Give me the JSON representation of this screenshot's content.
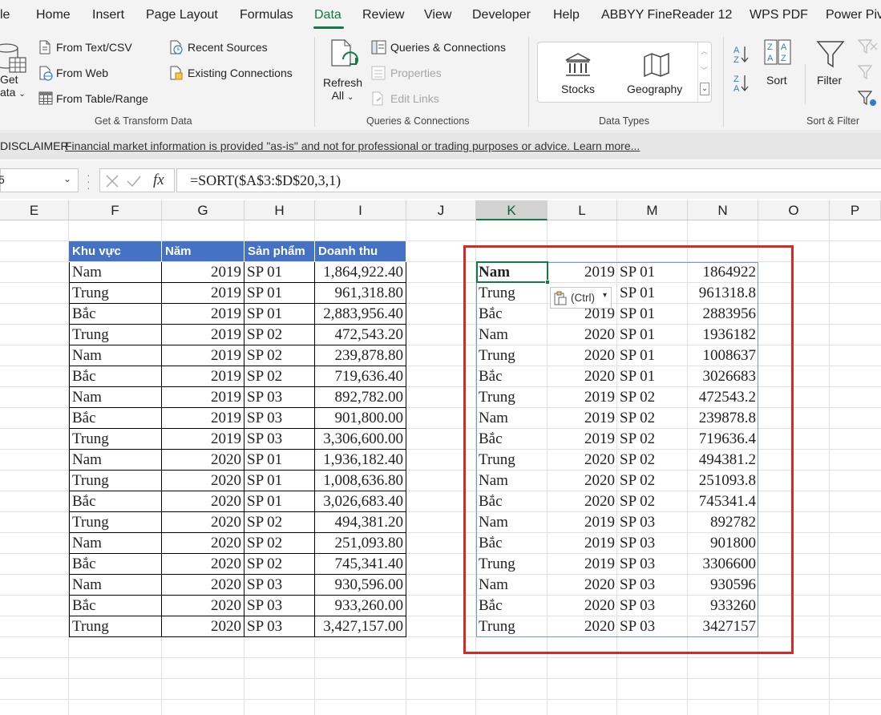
{
  "ribbon_tabs": [
    "le",
    "Home",
    "Insert",
    "Page Layout",
    "Formulas",
    "Data",
    "Review",
    "View",
    "Developer",
    "Help",
    "ABBYY FineReader 12",
    "WPS PDF",
    "Power Piv"
  ],
  "active_tab": "Data",
  "ribbon": {
    "get_data_line1": "Get",
    "get_data_line2": "ata",
    "get_transform_items": [
      "From Text/CSV",
      "From Web",
      "From Table/Range"
    ],
    "recent_sources": "Recent Sources",
    "existing_connections": "Existing Connections",
    "get_transform_label": "Get & Transform Data",
    "refresh_line1": "Refresh",
    "refresh_line2": "All",
    "queries_connections": "Queries & Connections",
    "properties": "Properties",
    "edit_links": "Edit Links",
    "queries_label": "Queries & Connections",
    "stocks": "Stocks",
    "geography": "Geography",
    "data_types_label": "Data Types",
    "sort": "Sort",
    "filter": "Filter",
    "sort_filter_label": "Sort & Filter"
  },
  "disclaimer": {
    "label": "DISCLAIMER",
    "text": "Financial market information is provided \"as-is\" and not for professional or trading purposes or advice. Learn more..."
  },
  "formula_bar": {
    "name_box": "5",
    "fx": "fx",
    "formula": "=SORT($A$3:$D$20,3,1)"
  },
  "columns": [
    "E",
    "F",
    "G",
    "H",
    "I",
    "J",
    "K",
    "L",
    "M",
    "N",
    "O",
    "P"
  ],
  "selected_column": "K",
  "source_table": {
    "headers": [
      "Khu vực",
      "Năm",
      "Sản phẩm",
      "Doanh thu"
    ],
    "rows": [
      [
        "Nam",
        "2019",
        "SP 01",
        "1,864,922.40"
      ],
      [
        "Trung",
        "2019",
        "SP 01",
        "961,318.80"
      ],
      [
        "Bắc",
        "2019",
        "SP 01",
        "2,883,956.40"
      ],
      [
        "Trung",
        "2019",
        "SP 02",
        "472,543.20"
      ],
      [
        "Nam",
        "2019",
        "SP 02",
        "239,878.80"
      ],
      [
        "Bắc",
        "2019",
        "SP 02",
        "719,636.40"
      ],
      [
        "Nam",
        "2019",
        "SP 03",
        "892,782.00"
      ],
      [
        "Bắc",
        "2019",
        "SP 03",
        "901,800.00"
      ],
      [
        "Trung",
        "2019",
        "SP 03",
        "3,306,600.00"
      ],
      [
        "Nam",
        "2020",
        "SP 01",
        "1,936,182.40"
      ],
      [
        "Trung",
        "2020",
        "SP 01",
        "1,008,636.80"
      ],
      [
        "Bắc",
        "2020",
        "SP 01",
        "3,026,683.40"
      ],
      [
        "Trung",
        "2020",
        "SP 02",
        "494,381.20"
      ],
      [
        "Nam",
        "2020",
        "SP 02",
        "251,093.80"
      ],
      [
        "Bắc",
        "2020",
        "SP 02",
        "745,341.40"
      ],
      [
        "Nam",
        "2020",
        "SP 03",
        "930,596.00"
      ],
      [
        "Bắc",
        "2020",
        "SP 03",
        "933,260.00"
      ],
      [
        "Trung",
        "2020",
        "SP 03",
        "3,427,157.00"
      ]
    ]
  },
  "sorted_result": {
    "rows": [
      [
        "Nam",
        "2019",
        "SP 01",
        "1864922"
      ],
      [
        "Trung",
        "",
        "SP 01",
        "961318.8"
      ],
      [
        "Bắc",
        "2019",
        "SP 01",
        "2883956"
      ],
      [
        "Nam",
        "2020",
        "SP 01",
        "1936182"
      ],
      [
        "Trung",
        "2020",
        "SP 01",
        "1008637"
      ],
      [
        "Bắc",
        "2020",
        "SP 01",
        "3026683"
      ],
      [
        "Trung",
        "2019",
        "SP 02",
        "472543.2"
      ],
      [
        "Nam",
        "2019",
        "SP 02",
        "239878.8"
      ],
      [
        "Bắc",
        "2019",
        "SP 02",
        "719636.4"
      ],
      [
        "Trung",
        "2020",
        "SP 02",
        "494381.2"
      ],
      [
        "Nam",
        "2020",
        "SP 02",
        "251093.8"
      ],
      [
        "Bắc",
        "2020",
        "SP 02",
        "745341.4"
      ],
      [
        "Nam",
        "2019",
        "SP 03",
        "892782"
      ],
      [
        "Bắc",
        "2019",
        "SP 03",
        "901800"
      ],
      [
        "Trung",
        "2019",
        "SP 03",
        "3306600"
      ],
      [
        "Nam",
        "2020",
        "SP 03",
        "930596"
      ],
      [
        "Bắc",
        "2020",
        "SP 03",
        "933260"
      ],
      [
        "Trung",
        "2020",
        "SP 03",
        "3427157"
      ]
    ]
  },
  "paste_options_label": "(Ctrl)",
  "colors": {
    "accent_green": "#107c41",
    "table_header_blue": "#4472c4",
    "highlight_red": "#d42a2a"
  }
}
